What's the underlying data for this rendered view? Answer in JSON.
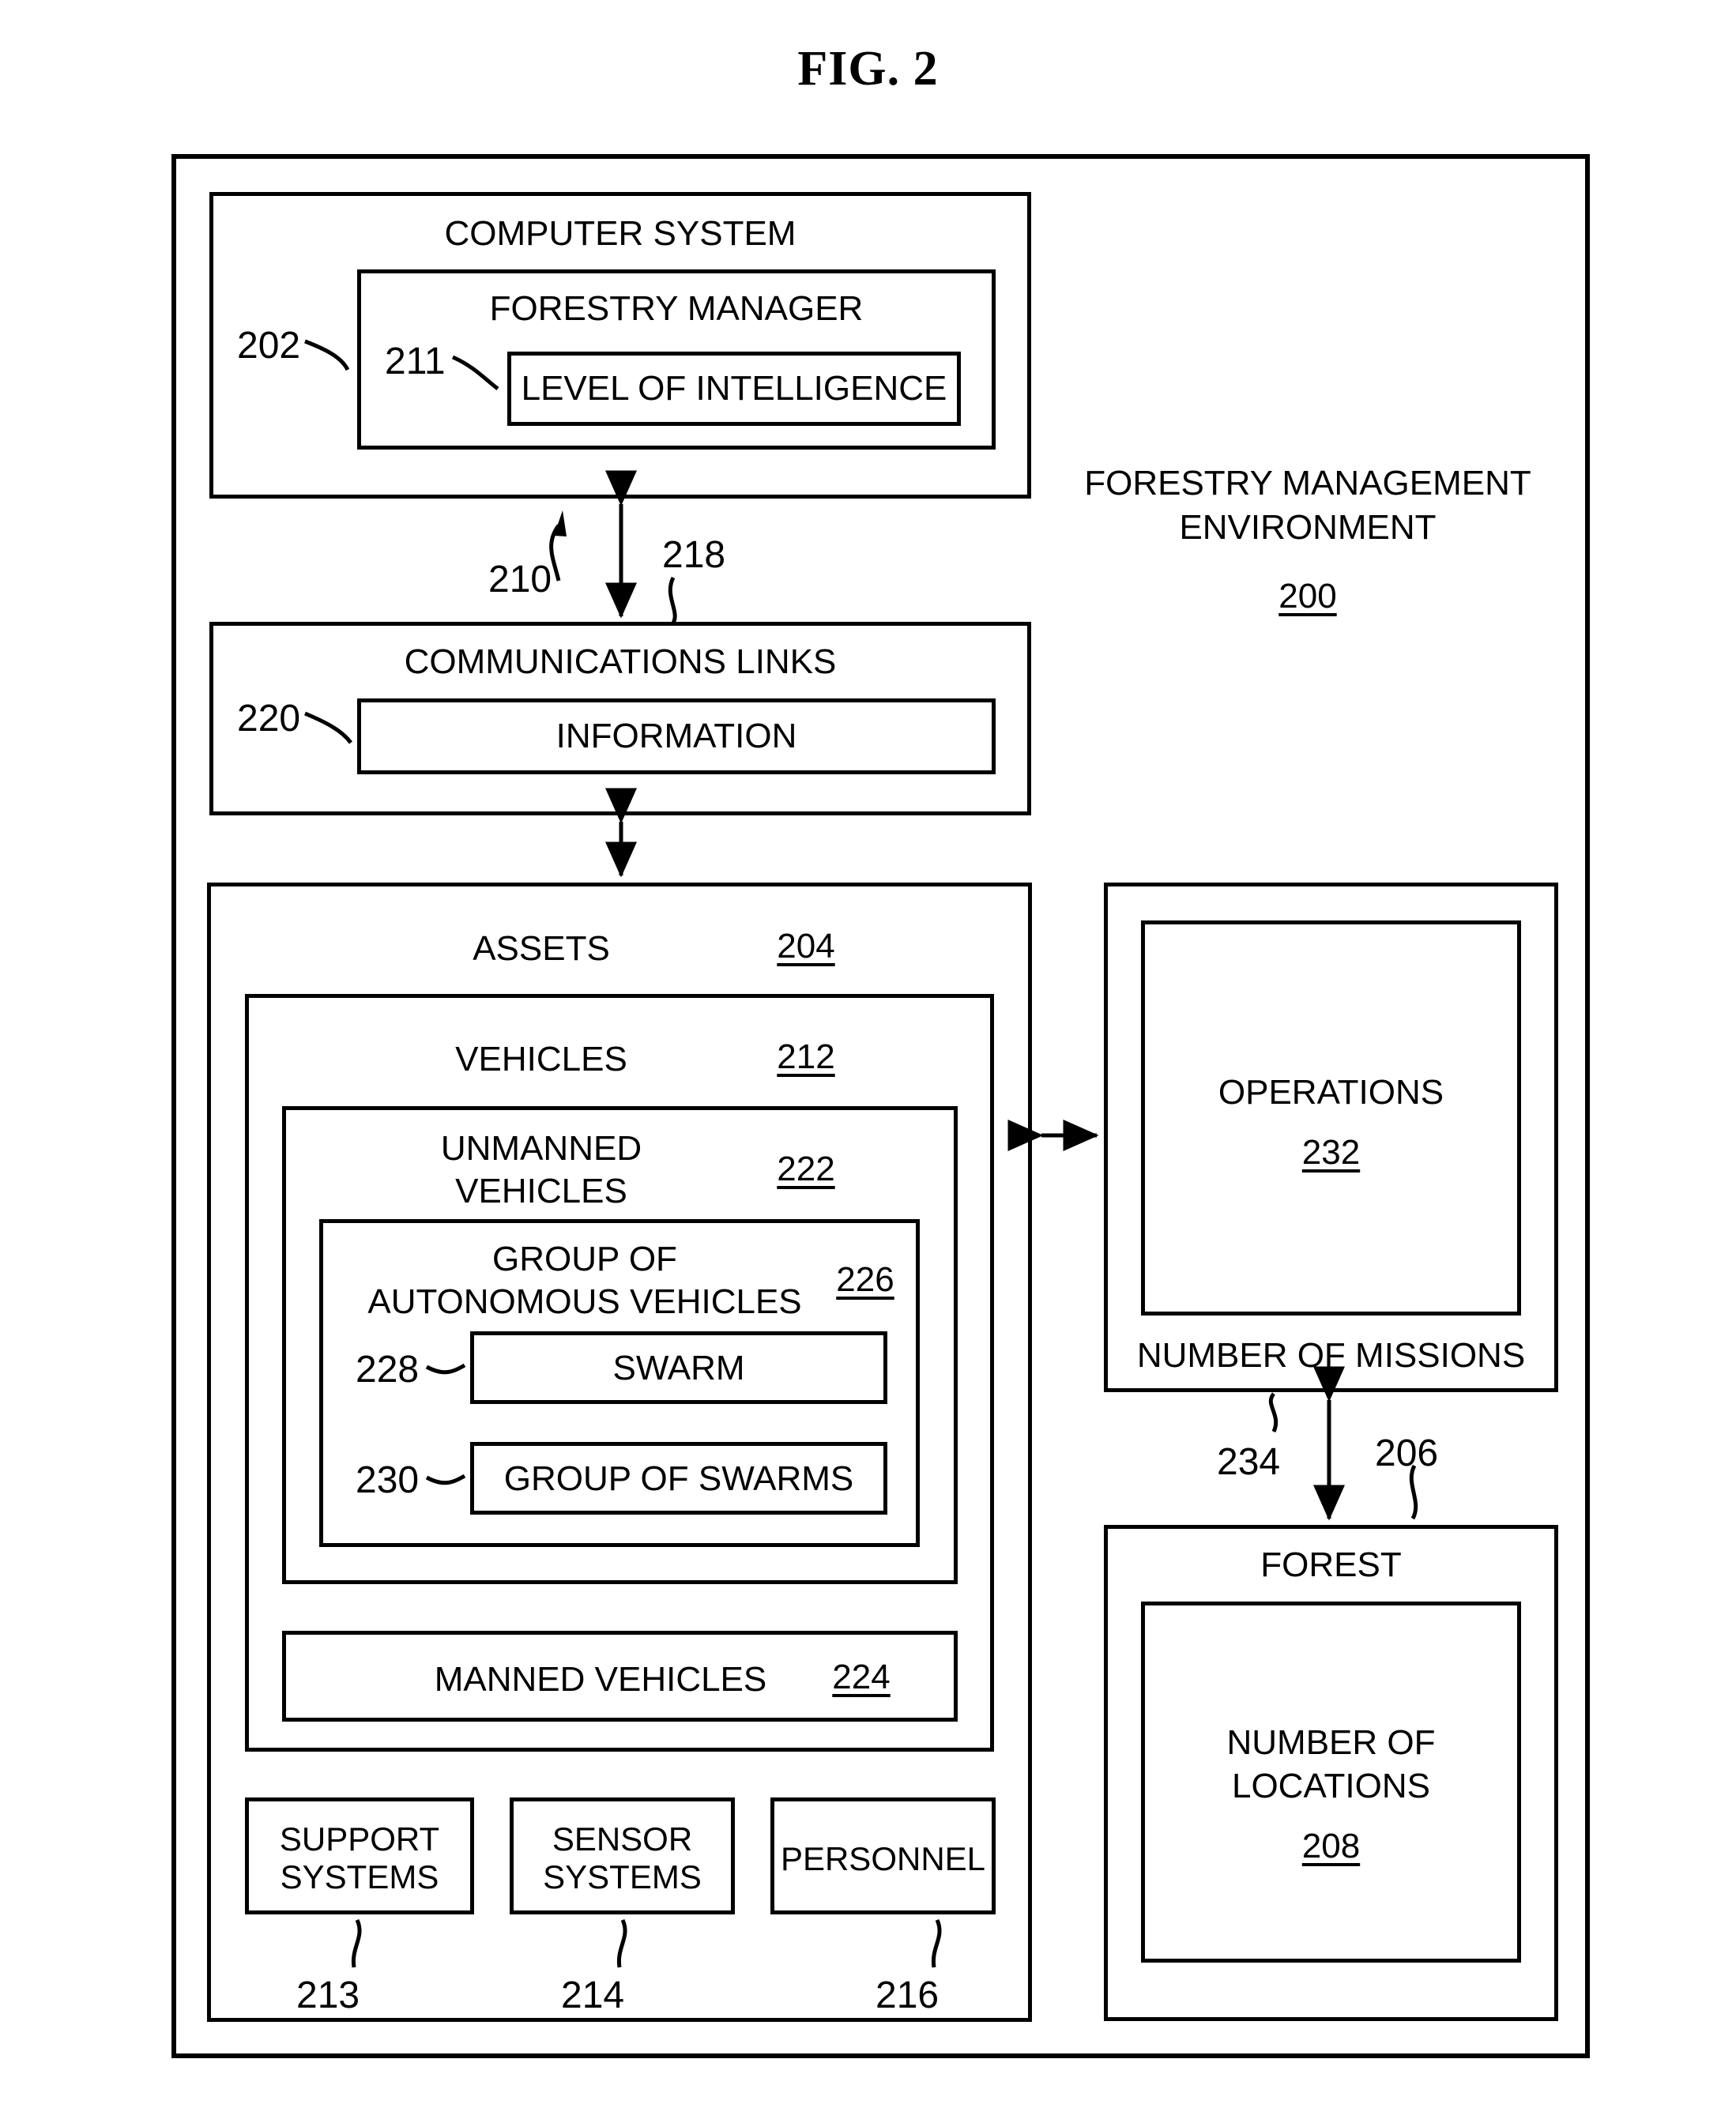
{
  "figure": {
    "title": "FIG. 2"
  },
  "environment": {
    "name_line1": "FORESTRY MANAGEMENT",
    "name_line2": "ENVIRONMENT",
    "ref": "200"
  },
  "computer_system": {
    "label": "COMPUTER SYSTEM",
    "ref": "202",
    "forestry_manager": {
      "label": "FORESTRY MANAGER",
      "ref": "211",
      "level_of_intelligence": {
        "label": "LEVEL OF INTELLIGENCE"
      }
    }
  },
  "connections": {
    "link_210": "210",
    "link_218": "218",
    "link_234": "234",
    "link_206": "206"
  },
  "communications_links": {
    "label": "COMMUNICATIONS LINKS",
    "information": {
      "label": "INFORMATION",
      "ref": "220"
    }
  },
  "assets": {
    "label": "ASSETS",
    "ref": "204",
    "vehicles": {
      "label": "VEHICLES",
      "ref": "212",
      "unmanned_vehicles": {
        "label_line1": "UNMANNED",
        "label_line2": "VEHICLES",
        "ref": "222",
        "group_of_autonomous_vehicles": {
          "label_line1": "GROUP OF",
          "label_line2": "AUTONOMOUS VEHICLES",
          "ref": "226",
          "swarm": {
            "label": "SWARM",
            "ref": "228"
          },
          "group_of_swarms": {
            "label": "GROUP OF SWARMS",
            "ref": "230"
          }
        }
      },
      "manned_vehicles": {
        "label": "MANNED VEHICLES",
        "ref": "224"
      }
    },
    "support_systems": {
      "label_line1": "SUPPORT",
      "label_line2": "SYSTEMS",
      "ref": "213"
    },
    "sensor_systems": {
      "label_line1": "SENSOR",
      "label_line2": "SYSTEMS",
      "ref": "214"
    },
    "personnel": {
      "label": "PERSONNEL",
      "ref": "216"
    }
  },
  "operations": {
    "label": "OPERATIONS",
    "ref": "232",
    "number_of_missions": {
      "label": "NUMBER OF MISSIONS"
    }
  },
  "forest": {
    "label": "FOREST",
    "number_of_locations": {
      "label_line1": "NUMBER OF",
      "label_line2": "LOCATIONS",
      "ref": "208"
    }
  }
}
